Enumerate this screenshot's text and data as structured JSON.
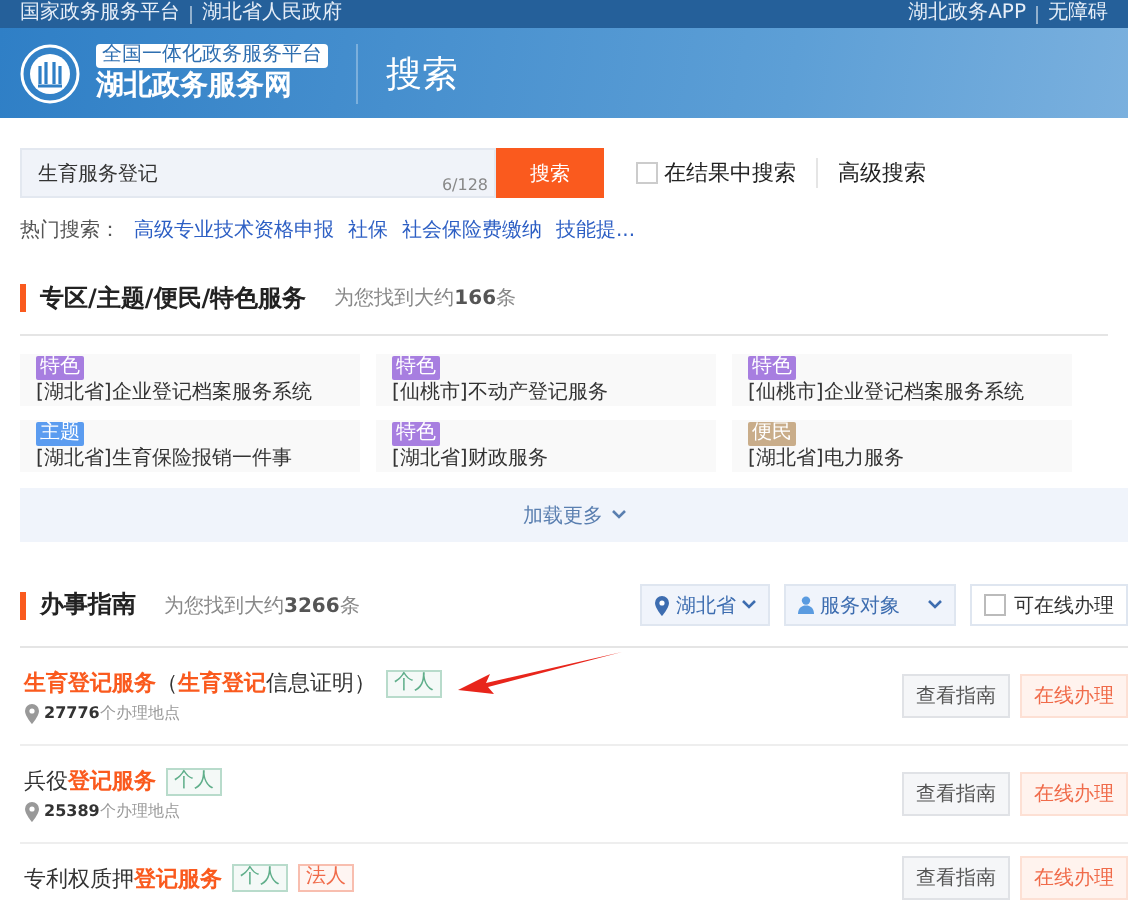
{
  "top_bar": {
    "left_links": [
      "国家政务服务平台",
      "湖北省人民政府"
    ],
    "right_links": [
      "湖北政务APP",
      "无障碍"
    ]
  },
  "header": {
    "platform_badge": "全国一体化政务服务平台",
    "site_name": "湖北政务服务网",
    "page_title": "搜索"
  },
  "search": {
    "value": "生育服务登记",
    "counter": "6/128",
    "button": "搜索",
    "in_results": {
      "label": "在结果中搜索",
      "checked": false
    },
    "advanced": "高级搜索"
  },
  "hot_search": {
    "label": "热门搜索：",
    "terms": [
      "高级专业技术资格申报",
      "社保",
      "社会保险费缴纳",
      "技能提..."
    ]
  },
  "special": {
    "title": "专区/主题/便民/特色服务",
    "count_prefix": "为您找到大约",
    "count": "166",
    "count_suffix": "条",
    "items": [
      {
        "tag": "特色",
        "color": "#a77ee0",
        "name": "[湖北省]企业登记档案服务系统"
      },
      {
        "tag": "特色",
        "color": "#a77ee0",
        "name": "[仙桃市]不动产登记服务"
      },
      {
        "tag": "特色",
        "color": "#a77ee0",
        "name": "[仙桃市]企业登记档案服务系统"
      },
      {
        "tag": "主题",
        "color": "#5b9cf0",
        "name": "[湖北省]生育保险报销一件事"
      },
      {
        "tag": "特色",
        "color": "#a77ee0",
        "name": "[湖北省]财政服务"
      },
      {
        "tag": "便民",
        "color": "#c9ad8a",
        "name": "[湖北省]电力服务"
      }
    ],
    "load_more": "加载更多"
  },
  "guide": {
    "title": "办事指南",
    "count_prefix": "为您找到大约",
    "count": "3266",
    "count_suffix": "条",
    "filters": {
      "region": "湖北省",
      "audience": "服务对象",
      "online": {
        "label": "可在线办理",
        "checked": false
      }
    },
    "results": [
      {
        "title": "**生育登记服务**（**生育登记**信息证明）",
        "tags": [
          {
            "label": "个人",
            "color": "#5fae8a"
          }
        ],
        "points": "27776",
        "points_suffix": "个办理地点",
        "view": "查看指南",
        "apply": "在线办理",
        "annotated": true
      },
      {
        "title": "兵役**登记服务**",
        "tags": [
          {
            "label": "个人",
            "color": "#5fae8a"
          }
        ],
        "points": "25389",
        "points_suffix": "个办理地点",
        "view": "查看指南",
        "apply": "在线办理",
        "annotated": false
      },
      {
        "title": "专利权质押**登记服务**",
        "tags": [
          {
            "label": "个人",
            "color": "#5fae8a"
          },
          {
            "label": "法人",
            "color": "#f06b4a"
          }
        ],
        "view": "查看指南",
        "apply": "在线办理",
        "annotated": false
      }
    ]
  }
}
